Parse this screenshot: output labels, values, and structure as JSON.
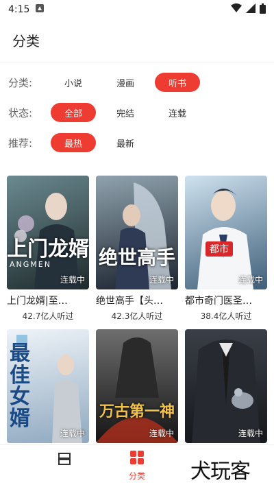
{
  "status": {
    "time": "4:15"
  },
  "header": {
    "title": "分类"
  },
  "filters": {
    "category": {
      "label": "分类:",
      "options": [
        "小说",
        "漫画",
        "听书"
      ],
      "active": 2
    },
    "state": {
      "label": "状态:",
      "options": [
        "全部",
        "完结",
        "连载"
      ],
      "active": 0
    },
    "recommend": {
      "label": "推荐:",
      "options": [
        "最热",
        "最新"
      ],
      "active": 0
    }
  },
  "books": [
    {
      "title": "上门龙婿|至…",
      "listeners": "42.7亿人听过",
      "status": "连载中",
      "cover_text": "上门龙婿",
      "cover_sub": "ANGMEN",
      "colors": [
        "#4a6b73",
        "#1e2a2c"
      ]
    },
    {
      "title": "绝世高手【头…",
      "listeners": "42.3亿人听过",
      "status": "连载中",
      "cover_text": "绝世高手",
      "colors": [
        "#6d7f8c",
        "#1c2430"
      ]
    },
    {
      "title": "都市奇门医圣…",
      "listeners": "38.4亿人听过",
      "status": "连载中",
      "cover_text": "都市",
      "colors": [
        "#a7c8e0",
        "#3f5f7a"
      ]
    },
    {
      "title": "",
      "listeners": "",
      "status": "连载中",
      "cover_text": "最佳女婿",
      "colors": [
        "#dfe9f2",
        "#7d9bb5"
      ]
    },
    {
      "title": "",
      "listeners": "",
      "status": "连载中",
      "cover_text": "万古第一神",
      "colors": [
        "#5a5a5a",
        "#1a1a1a"
      ]
    },
    {
      "title": "",
      "listeners": "",
      "status": "连载中",
      "cover_text": "",
      "colors": [
        "#2b2f36",
        "#15181c"
      ]
    }
  ],
  "nav": {
    "items": [
      "",
      "分类"
    ],
    "active": 1
  },
  "watermark": "犬玩客",
  "accent": "#ee3c32"
}
